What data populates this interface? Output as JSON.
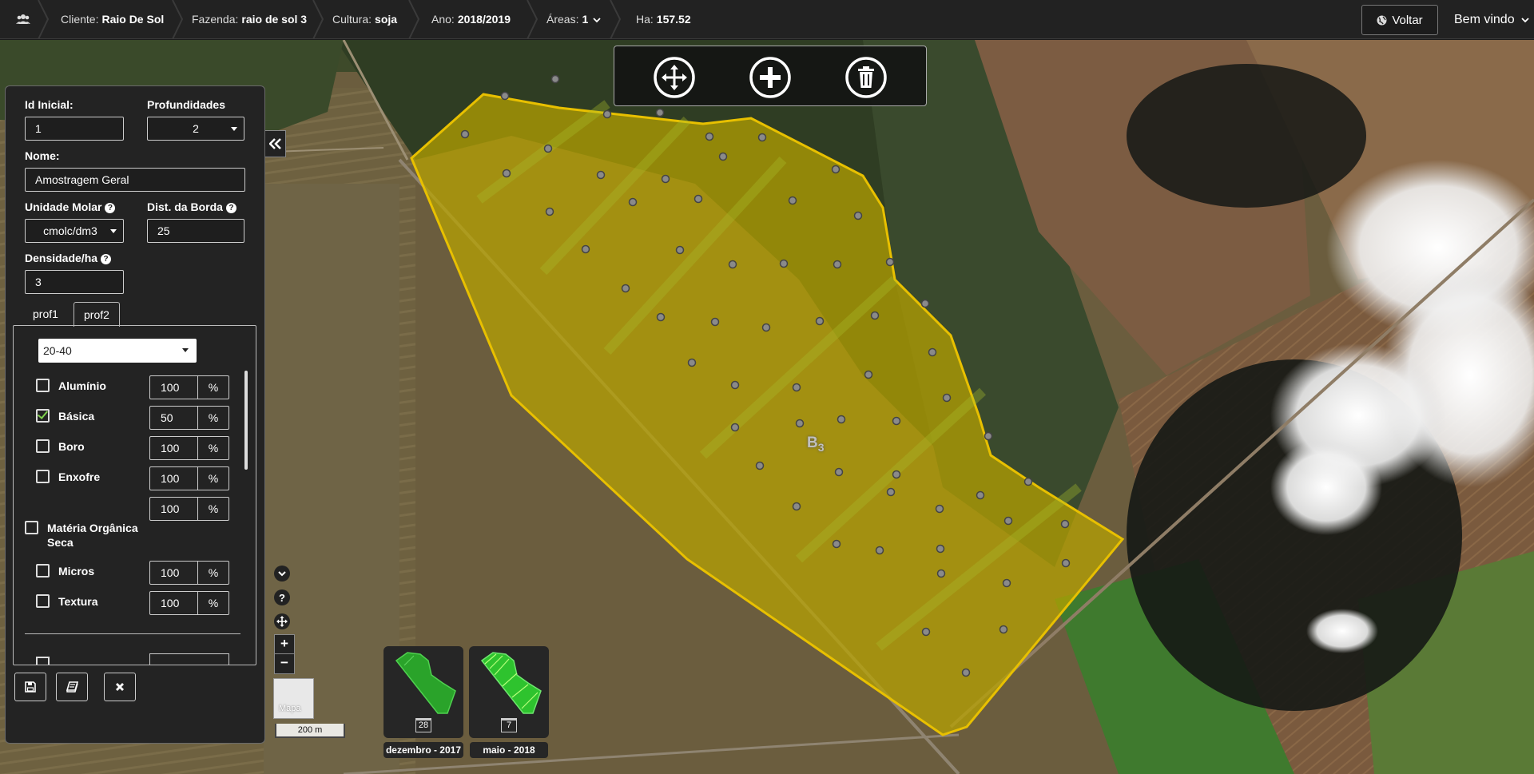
{
  "nav": {
    "cliente_label": "Cliente:",
    "cliente_value": "Raio De Sol",
    "fazenda_label": "Fazenda:",
    "fazenda_value": "raio de sol 3",
    "cultura_label": "Cultura:",
    "cultura_value": "soja",
    "ano_label": "Ano:",
    "ano_value": "2018/2019",
    "areas_label": "Áreas:",
    "areas_value": "1",
    "ha_label": "Ha:",
    "ha_value": "157.52",
    "voltar_label": "Voltar",
    "bem_vindo": "Bem vindo"
  },
  "panel": {
    "id_inicial_label": "Id Inicial:",
    "id_inicial_value": "1",
    "profundidades_label": "Profundidades",
    "profundidades_value": "2",
    "nome_label": "Nome:",
    "nome_value": "Amostragem Geral",
    "unidade_molar_label": "Unidade Molar",
    "unidade_molar_value": "cmolc/dm3",
    "dist_borda_label": "Dist. da Borda",
    "dist_borda_value": "25",
    "densidade_label": "Densidade/ha",
    "densidade_value": "3",
    "tabs": [
      {
        "label": "prof1",
        "active": false
      },
      {
        "label": "prof2",
        "active": true
      }
    ],
    "depth_range": "20-40",
    "nutrients": [
      {
        "name": "Alumínio",
        "checked": false,
        "value": "100",
        "unit": "%"
      },
      {
        "name": "Básica",
        "checked": true,
        "value": "50",
        "unit": "%"
      },
      {
        "name": "Boro",
        "checked": false,
        "value": "100",
        "unit": "%"
      },
      {
        "name": "Enxofre",
        "checked": false,
        "value": "100",
        "unit": "%"
      },
      {
        "name": "",
        "checked": false,
        "value": "100",
        "unit": "%"
      },
      {
        "name": "Matéria Orgânica Seca",
        "checked": false,
        "value": "",
        "unit": ""
      },
      {
        "name": "Micros",
        "checked": false,
        "value": "100",
        "unit": "%"
      },
      {
        "name": "Textura",
        "checked": false,
        "value": "100",
        "unit": "%"
      }
    ]
  },
  "map": {
    "field_label": "B",
    "field_label_sub": "3",
    "mapa_label": "Mapa",
    "scale_label": "200 m",
    "imagery": [
      {
        "day": "28",
        "date": "dezembro - 2017"
      },
      {
        "day": "7",
        "date": "maio - 2018"
      }
    ],
    "colors": {
      "field_fill": "#b8a300",
      "field_stroke": "#e8c000",
      "accent_check": "#7fd14d"
    }
  }
}
